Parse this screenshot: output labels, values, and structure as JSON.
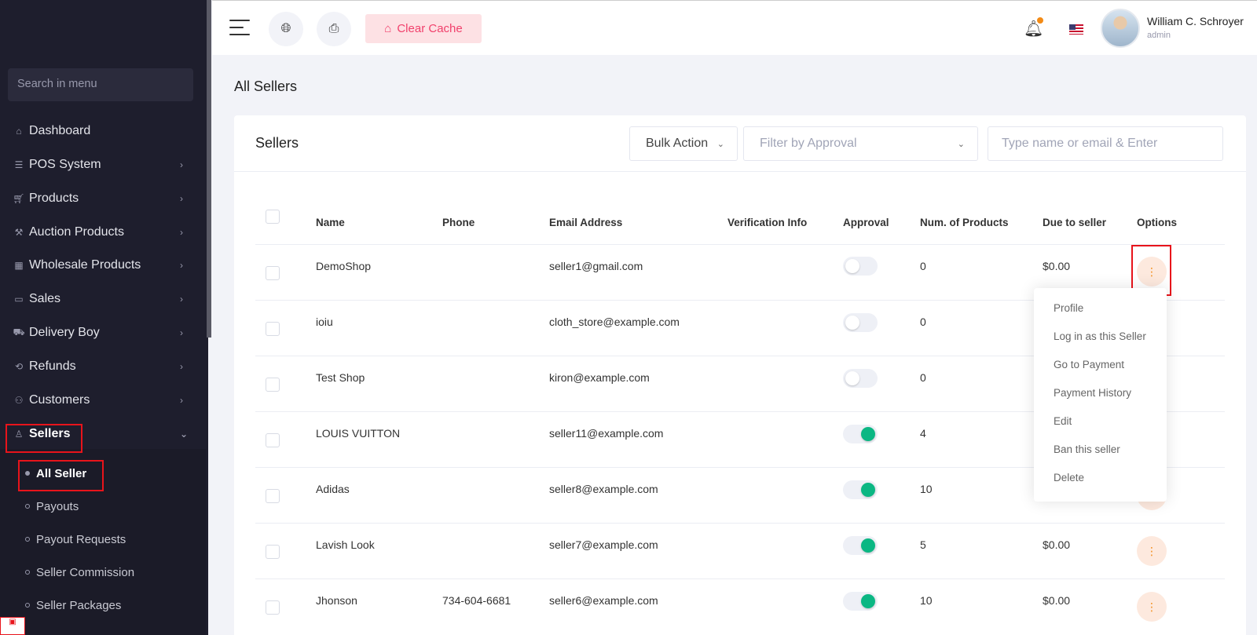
{
  "sidebar": {
    "search_placeholder": "Search in menu",
    "items": [
      {
        "label": "Dashboard",
        "icon": "home-icon"
      },
      {
        "label": "POS System",
        "icon": "list-icon"
      },
      {
        "label": "Products",
        "icon": "cart-icon"
      },
      {
        "label": "Auction Products",
        "icon": "gavel-icon"
      },
      {
        "label": "Wholesale Products",
        "icon": "warehouse-icon"
      },
      {
        "label": "Sales",
        "icon": "money-icon"
      },
      {
        "label": "Delivery Boy",
        "icon": "truck-icon"
      },
      {
        "label": "Refunds",
        "icon": "refund-icon"
      },
      {
        "label": "Customers",
        "icon": "users-icon"
      },
      {
        "label": "Sellers",
        "icon": "user-icon"
      }
    ],
    "seller_sub": [
      "All Seller",
      "Payouts",
      "Payout Requests",
      "Seller Commission",
      "Seller Packages"
    ]
  },
  "topbar": {
    "clear_cache": "Clear Cache",
    "user_name": "William C. Schroyer",
    "user_role": "admin"
  },
  "page": {
    "title": "All Sellers",
    "card_title": "Sellers",
    "bulk_action": "Bulk Action",
    "filter_placeholder": "Filter by Approval",
    "search_placeholder": "Type name or email & Enter"
  },
  "table": {
    "headers": [
      "Name",
      "Phone",
      "Email Address",
      "Verification Info",
      "Approval",
      "Num. of Products",
      "Due to seller",
      "Options"
    ],
    "rows": [
      {
        "name": "DemoShop",
        "phone": "",
        "email": "seller1@gmail.com",
        "approved": false,
        "products": "0",
        "due": "$0.00"
      },
      {
        "name": "ioiu",
        "phone": "",
        "email": "cloth_store@example.com",
        "approved": false,
        "products": "0",
        "due": ""
      },
      {
        "name": "Test Shop",
        "phone": "",
        "email": "kiron@example.com",
        "approved": false,
        "products": "0",
        "due": ""
      },
      {
        "name": "LOUIS VUITTON",
        "phone": "",
        "email": "seller11@example.com",
        "approved": true,
        "products": "4",
        "due": ""
      },
      {
        "name": "Adidas",
        "phone": "",
        "email": "seller8@example.com",
        "approved": true,
        "products": "10",
        "due": ""
      },
      {
        "name": "Lavish Look",
        "phone": "",
        "email": "seller7@example.com",
        "approved": true,
        "products": "5",
        "due": "$0.00"
      },
      {
        "name": "Jhonson",
        "phone": "734-604-6681",
        "email": "seller6@example.com",
        "approved": true,
        "products": "10",
        "due": "$0.00"
      }
    ]
  },
  "options_menu": [
    "Profile",
    "Log in as this Seller",
    "Go to Payment",
    "Payment History",
    "Edit",
    "Ban this seller",
    "Delete"
  ],
  "colors": {
    "sidebar_bg": "#1e1e2d",
    "accent_red": "#f1416c",
    "toggle_on": "#0bb783",
    "option_btn": "#fde9de"
  }
}
